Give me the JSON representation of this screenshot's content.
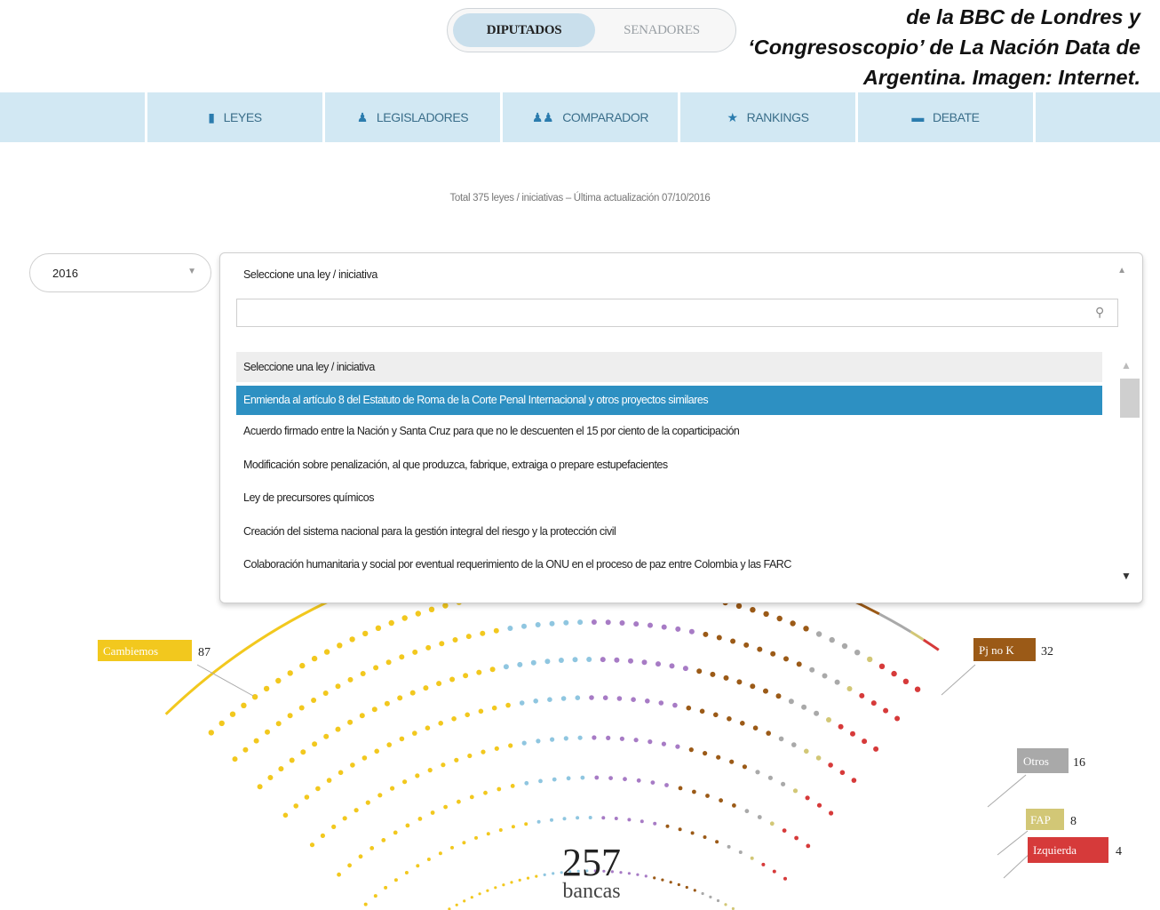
{
  "toggle": {
    "diputados": "DIPUTADOS",
    "senadores": "SENADORES"
  },
  "caption": "de la BBC de Londres y ‘Congresoscopio’ de La Nación Data de Argentina. Imagen: Internet.",
  "nav": [
    {
      "label": "LEYES",
      "icon": "book-icon",
      "glyph": "▮"
    },
    {
      "label": "LEGISLADORES",
      "icon": "user-icon",
      "glyph": "♟"
    },
    {
      "label": "COMPARADOR",
      "icon": "users-icon",
      "glyph": "♟♟"
    },
    {
      "label": "RANKINGS",
      "icon": "star-icon",
      "glyph": "★"
    },
    {
      "label": "DEBATE",
      "icon": "comment-icon",
      "glyph": "▬"
    }
  ],
  "meta": "Total 375 leyes / iniciativas – Última actualización 07/10/2016",
  "year_select": {
    "value": "2016"
  },
  "law_select": {
    "header": "Seleccione una ley / iniciativa",
    "search_value": "",
    "options": [
      "Seleccione una ley / iniciativa",
      "Enmienda al artículo 8 del Estatuto de Roma de la Corte Penal Internacional y otros proyectos similares",
      "Acuerdo firmado entre la Nación y Santa Cruz para que no le descuenten el 15 por ciento de la coparticipación",
      "Modificación sobre penalización, al que produzca, fabrique, extraiga o prepare estupefacientes",
      "Ley de precursores químicos",
      "Creación del sistema nacional para la gestión integral del riesgo y la protección civil",
      "Colaboración humanitaria y social por eventual requerimiento de la ONU en el proceso de paz entre Colombia y las FARC"
    ],
    "selected_index": 1
  },
  "chart_data": {
    "type": "parliament",
    "total": {
      "value": "257",
      "label": "bancas"
    },
    "blocs": [
      {
        "name": "Cambiemos",
        "seats": 87,
        "color": "#f2c81e"
      },
      {
        "name": "Pj no K",
        "seats": 32,
        "color": "#9b5a17"
      },
      {
        "name": "Otros",
        "seats": 16,
        "color": "#a9a9a9"
      },
      {
        "name": "FAP",
        "seats": 8,
        "color": "#d2c776"
      },
      {
        "name": "Izquierda",
        "seats": 4,
        "color": "#d63a3a"
      }
    ],
    "other_dot_colors": [
      "#8fc6e0",
      "#a77bc5"
    ]
  }
}
